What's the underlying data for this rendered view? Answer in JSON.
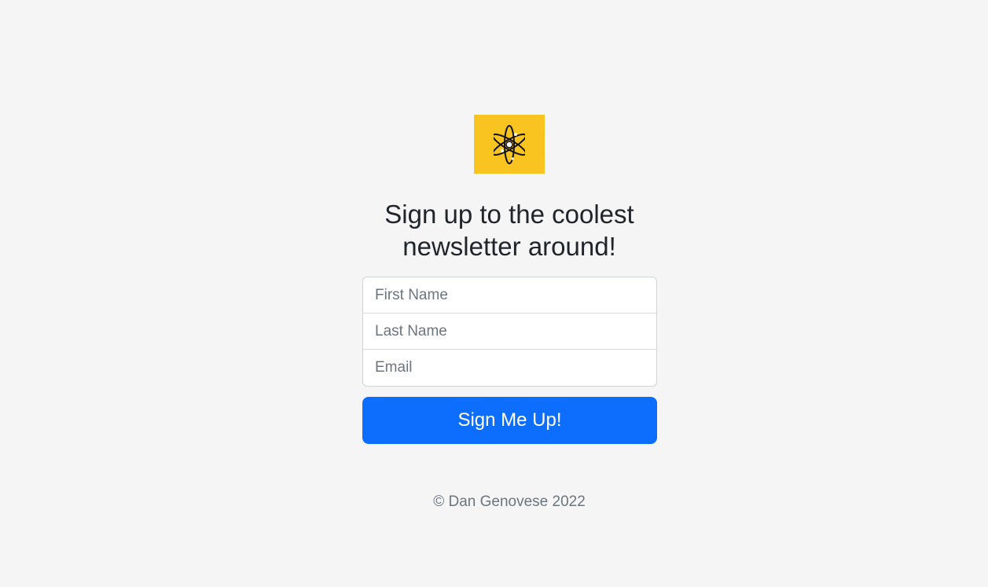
{
  "logo": {
    "icon": "atom-icon",
    "background": "#f9c320"
  },
  "heading": "Sign up to the coolest newsletter around!",
  "form": {
    "first_name_placeholder": "First Name",
    "last_name_placeholder": "Last Name",
    "email_placeholder": "Email",
    "submit_label": "Sign Me Up!",
    "submit_color": "#0d6efd"
  },
  "footer": "© Dan Genovese 2022"
}
